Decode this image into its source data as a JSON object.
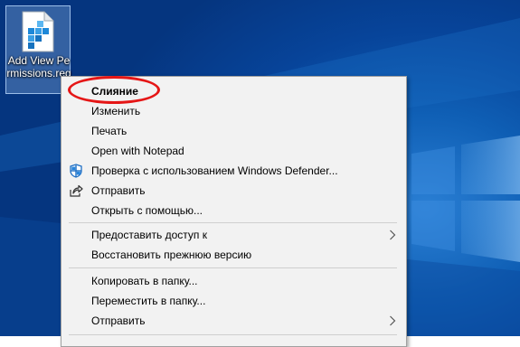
{
  "desktop": {
    "icon": {
      "name": "registry-file-icon",
      "label": "Add View Permissions.reg"
    }
  },
  "menu": {
    "items": [
      {
        "label": "Слияние",
        "bold": true
      },
      {
        "label": "Изменить"
      },
      {
        "label": "Печать"
      },
      {
        "label": "Open with Notepad"
      },
      {
        "label": "Проверка с использованием Windows Defender...",
        "icon": "windows-defender-icon"
      },
      {
        "label": "Отправить",
        "icon": "share-icon"
      },
      {
        "label": "Открыть с помощью..."
      },
      {
        "label": "Предоставить доступ к",
        "submenu": true
      },
      {
        "label": "Восстановить прежнюю версию"
      },
      {
        "label": "Копировать в папку..."
      },
      {
        "label": "Переместить в папку..."
      },
      {
        "label": "Отправить",
        "submenu": true
      }
    ]
  },
  "colors": {
    "highlight_ring": "#e51616",
    "menu_background": "#f2f2f2",
    "desktop_blue": "#0f5fb5"
  }
}
